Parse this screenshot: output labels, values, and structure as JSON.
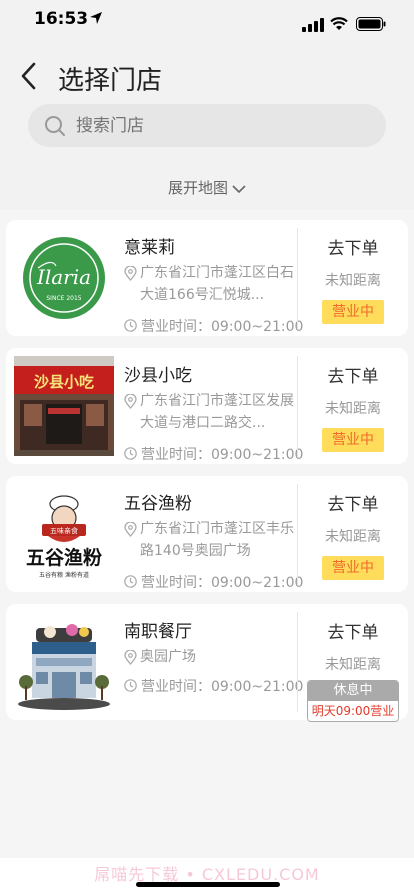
{
  "status_bar": {
    "time": "16:53"
  },
  "nav": {
    "title": "选择门店"
  },
  "search": {
    "placeholder": "搜索门店"
  },
  "map_toggle": {
    "label": "展开地图"
  },
  "stores": [
    {
      "name": "意莱莉",
      "address": "广东省江门市蓬江区白石大道166号汇悦城...",
      "hours": "营业时间：09:00~21:00",
      "order": "去下单",
      "distance": "未知距离",
      "status": "营业中",
      "logo_text": "Ilaria",
      "logo_sub": "SINCE 2015"
    },
    {
      "name": "沙县小吃",
      "address": "广东省江门市蓬江区发展大道与港口二路交...",
      "hours": "营业时间：09:00~21:00",
      "order": "去下单",
      "distance": "未知距离",
      "status": "营业中",
      "sign_text": "沙县小吃"
    },
    {
      "name": "五谷渔粉",
      "address": "广东省江门市蓬江区丰乐路140号奥园广场",
      "hours": "营业时间：09:00~21:00",
      "order": "去下单",
      "distance": "未知距离",
      "status": "营业中",
      "logo_badge": "五味亲食",
      "logo_main": "五谷渔粉",
      "logo_tagline": "五谷有粮  渔粉有道"
    },
    {
      "name": "南职餐厅",
      "address": "奥园广场",
      "hours": "营业时间：09:00~21:00",
      "order": "去下单",
      "distance": "未知距离",
      "status": "休息中",
      "status_note": "明天09:00营业"
    }
  ],
  "footer": {
    "watermark": "屌喵先下载 • CXLEDU.COM"
  },
  "colors": {
    "open_bg": "#ffdc5a",
    "open_text": "#f06a2f",
    "closed_text": "#e23b2b",
    "logo_green": "#3a9a4a"
  }
}
